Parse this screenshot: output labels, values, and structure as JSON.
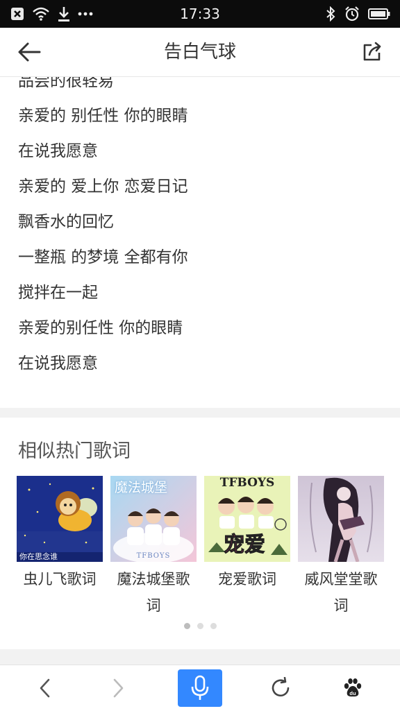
{
  "status_bar": {
    "time": "17:33",
    "left_icons": [
      "close-box-icon",
      "wifi-icon",
      "download-icon",
      "more-dots-icon"
    ],
    "right_icons": [
      "bluetooth-icon",
      "alarm-icon",
      "battery-icon"
    ]
  },
  "header": {
    "title": "告白气球",
    "back_icon": "back-arrow-icon",
    "share_icon": "share-icon"
  },
  "lyrics": {
    "partial_line": "品尝的很轻易",
    "lines": [
      "亲爱的 别任性 你的眼睛",
      "在说我愿意",
      "亲爱的 爱上你 恋爱日记",
      "飘香水的回忆",
      "一整瓶 的梦境 全都有你",
      "搅拌在一起",
      "亲爱的别任性 你的眼睛",
      "在说我愿意"
    ]
  },
  "similar": {
    "title": "相似热门歌词",
    "items": [
      {
        "label_line1": "虫儿飞歌词",
        "label_line2": "",
        "cover_text": "你在思念谁"
      },
      {
        "label_line1": "魔法城堡歌",
        "label_line2": "词",
        "cover_text": "魔法城堡",
        "cover_sub": "TFBOYS"
      },
      {
        "label_line1": "宠爱歌词",
        "label_line2": "",
        "cover_text": "TFBOYS",
        "cover_sub": "宠爱"
      },
      {
        "label_line1": "威风堂堂歌",
        "label_line2": "词",
        "cover_text": ""
      }
    ],
    "pager": {
      "count": 3,
      "active": 0
    }
  },
  "bottom_bar": {
    "icons": [
      "nav-back-icon",
      "nav-forward-icon",
      "microphone-icon",
      "refresh-icon",
      "baidu-paw-icon"
    ]
  },
  "colors": {
    "status_bg": "#0c0c0c",
    "accent": "#3388ff",
    "text": "#333333",
    "separator": "#f2f2f2"
  }
}
